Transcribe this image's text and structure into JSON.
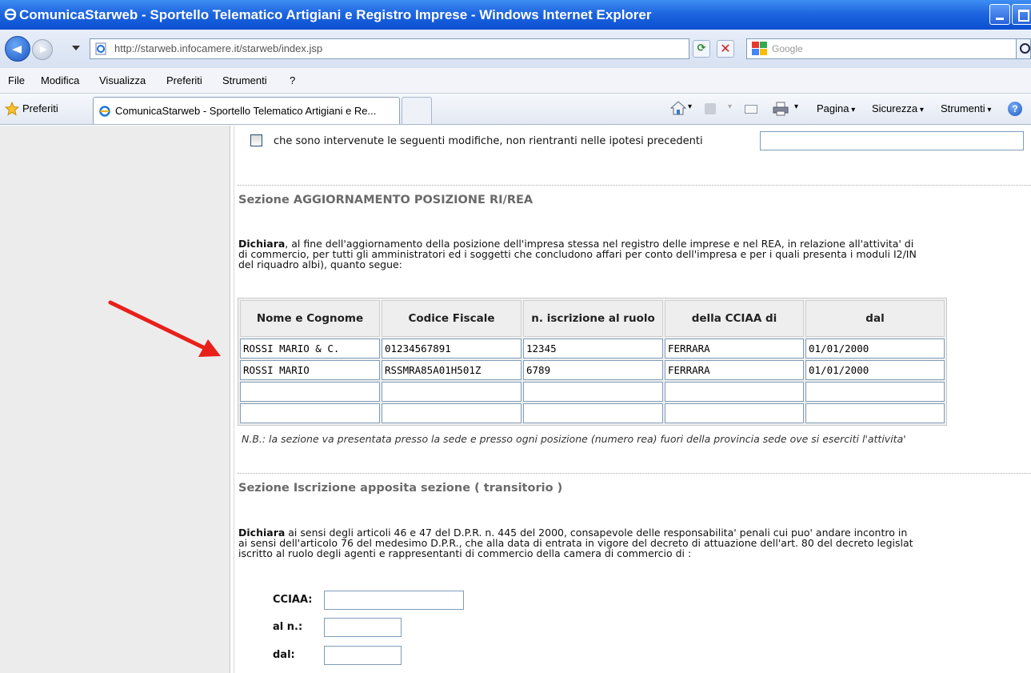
{
  "window": {
    "title": "ComunicaStarweb - Sportello Telematico Artigiani e Registro Imprese - Windows Internet Explorer"
  },
  "addressbar": {
    "url": "http://starweb.infocamere.it/starweb/index.jsp",
    "search_placeholder": "Google"
  },
  "menu": {
    "items": [
      "File",
      "Modifica",
      "Visualizza",
      "Preferiti",
      "Strumenti",
      "?"
    ]
  },
  "favbar": {
    "favorites_label": "Preferiti",
    "tab_title": "ComunicaStarweb - Sportello Telematico Artigiani e Re...",
    "commands": [
      "Pagina",
      "Sicurezza",
      "Strumenti"
    ]
  },
  "page": {
    "checkbox_label": "che sono intervenute le seguenti modifiche, non rientranti nelle ipotesi precedenti",
    "modifiche_value": "",
    "section1": {
      "title": "Sezione AGGIORNAMENTO POSIZIONE RI/REA",
      "para_bold": "Dichiara",
      "para_line1": ", al fine dell'aggiornamento della posizione dell'impresa stessa nel registro delle imprese e nel REA, in relazione all'attivita' di",
      "para_line2": "di commercio, per tutti gli amministratori ed i soggetti che concludono affari per conto dell'impresa e per i quali presenta i moduli I2/IN",
      "para_line3": "del riquadro albi), quanto segue:"
    },
    "table": {
      "headers": [
        "Nome e Cognome",
        "Codice Fiscale",
        "n. iscrizione al ruolo",
        "della CCIAA di",
        "dal"
      ],
      "rows": [
        [
          "ROSSI MARIO & C.",
          "01234567891",
          "12345",
          "FERRARA",
          "01/01/2000"
        ],
        [
          "ROSSI MARIO",
          "RSSMRA85A01H501Z",
          "6789",
          "FERRARA",
          "01/01/2000"
        ],
        [
          "",
          "",
          "",
          "",
          ""
        ],
        [
          "",
          "",
          "",
          "",
          ""
        ]
      ]
    },
    "note": "N.B.: la sezione va presentata presso la sede e presso ogni posizione (numero rea) fuori della provincia sede ove si eserciti l'attivita'",
    "section2": {
      "title": "Sezione Iscrizione apposita sezione ( transitorio )",
      "para_bold": "Dichiara",
      "para_line1": " ai sensi degli articoli 46 e 47 del D.P.R. n. 445 del 2000, consapevole delle responsabilita' penali cui puo' andare incontro in",
      "para_line2": "ai sensi dell'articolo 76 del medesimo D.P.R., che alla data di entrata in vigore del decreto di attuazione dell'art. 80 del decreto legislat",
      "para_line3": "iscritto al ruolo degli agenti e rappresentanti di commercio della camera di commercio di :"
    },
    "fields": {
      "cciaa_label": "CCIAA:",
      "aln_label": "al n.:",
      "dal_label": "dal:",
      "cciaa_value": "",
      "aln_value": "",
      "dal_value": ""
    }
  },
  "colors": {
    "titlebar": "#1e66e0",
    "section_title": "#6a6a6a",
    "arrow": "#e8201a"
  }
}
